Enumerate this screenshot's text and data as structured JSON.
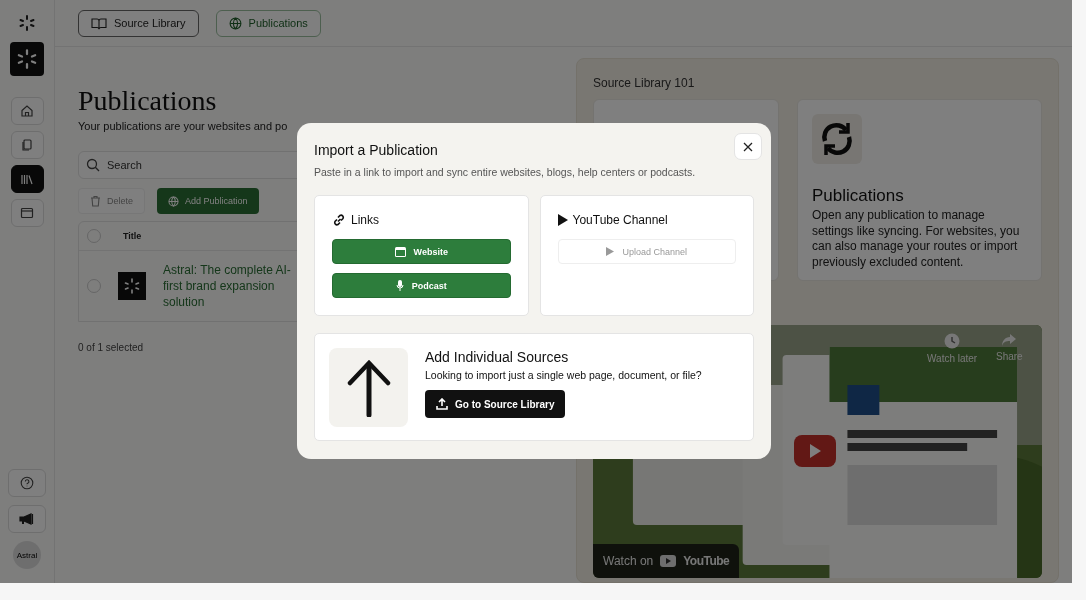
{
  "sidebar": {
    "nav": [
      {
        "selected": false
      },
      {
        "selected": false
      },
      {
        "selected": true
      },
      {
        "selected": false
      }
    ],
    "avatar": "Astral"
  },
  "top_tabs": [
    {
      "label": "Source Library",
      "selected": false
    },
    {
      "label": "Publications",
      "selected": true
    }
  ],
  "page": {
    "title": "Publications",
    "subtitle": "Your publications are your websites and po"
  },
  "search": {
    "placeholder": "Search"
  },
  "actions": [
    {
      "label": "Delete",
      "disabled": true
    },
    {
      "label": "Add Publication",
      "disabled": false
    }
  ],
  "table": {
    "columns": [
      "Title"
    ],
    "header_checked": false,
    "rows": [
      {
        "title": "Astral: The complete AI-first brand expansion solution",
        "checked": false
      }
    ]
  },
  "selection_count": "0 of 1 selected",
  "guide": {
    "title": "Source Library 101",
    "cards": [
      {
        "title": "Publications",
        "text": "Open any publication to manage settings like syncing. For websites, you can also manage your routes or import previously excluded content."
      }
    ],
    "video": {
      "watch_later": "Watch later",
      "share": "Share",
      "watch_on": "Watch on",
      "logo": "YouTube"
    }
  },
  "modal": {
    "title": "Import a Publication",
    "description": "Paste in a link to import and sync entire websites, blogs, help centers or podcasts.",
    "sections": [
      {
        "title": "Links",
        "buttons": [
          {
            "label": "Website",
            "disabled": false
          },
          {
            "label": "Podcast",
            "disabled": false
          }
        ]
      },
      {
        "title": "YouTube Channel",
        "buttons": [
          {
            "label": "Upload Channel",
            "disabled": true
          }
        ]
      }
    ],
    "individual": {
      "title": "Add Individual Sources",
      "text": "Looking to import just a single web page, document, or file?",
      "button": "Go to Source Library"
    }
  }
}
